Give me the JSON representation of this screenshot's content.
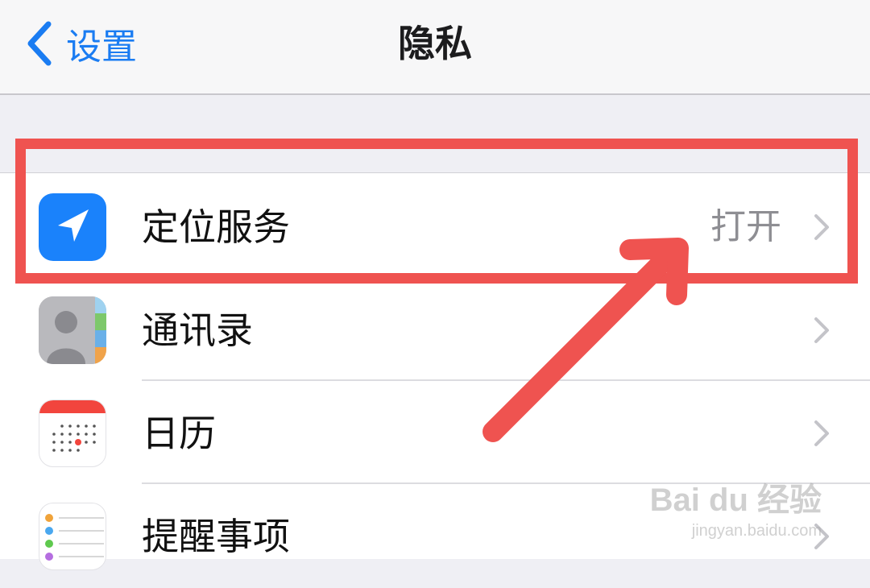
{
  "nav": {
    "back_label": "设置",
    "title": "隐私"
  },
  "rows": [
    {
      "label": "定位服务",
      "value": "打开",
      "icon": "location-arrow-icon",
      "icon_color": "#1a82fb"
    },
    {
      "label": "通讯录",
      "value": "",
      "icon": "contacts-icon"
    },
    {
      "label": "日历",
      "value": "",
      "icon": "calendar-icon"
    },
    {
      "label": "提醒事项",
      "value": "",
      "icon": "reminders-icon"
    }
  ],
  "annotation": {
    "highlight_color": "#ef5350",
    "target": "定位服务"
  },
  "watermark": {
    "brand": "Bai du 经验",
    "url": "jingyan.baidu.com"
  },
  "colors": {
    "accent": "#1a7cf2",
    "secondary_text": "#8e8e93"
  }
}
